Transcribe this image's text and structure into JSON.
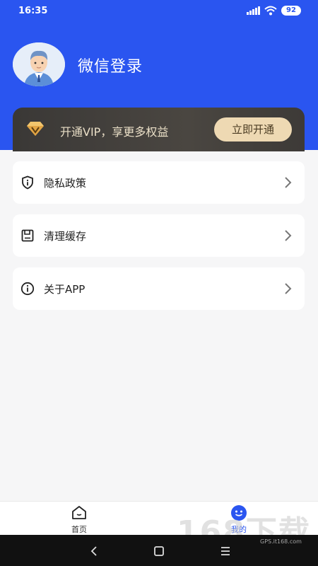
{
  "status_bar": {
    "time": "16:35",
    "battery": "92"
  },
  "header": {
    "title": "微信登录",
    "avatar_icon": "avatar-icon"
  },
  "vip": {
    "text": "开通VIP，享更多权益",
    "button": "立即开通",
    "icon": "vip-diamond-icon"
  },
  "menu": {
    "items": [
      {
        "label": "隐私政策",
        "icon": "shield-icon"
      },
      {
        "label": "清理缓存",
        "icon": "storage-icon"
      },
      {
        "label": "关于APP",
        "icon": "info-icon"
      }
    ]
  },
  "tabbar": {
    "items": [
      {
        "label": "首页",
        "icon": "home-icon"
      },
      {
        "label": "我的",
        "icon": "profile-icon",
        "active": true
      }
    ]
  },
  "watermark": {
    "main": "168下载",
    "small": "GPS.it168.com"
  },
  "colors": {
    "primary": "#2a55f0",
    "vip_gold": "#eed9b3",
    "vip_dark": "#3a3836"
  }
}
